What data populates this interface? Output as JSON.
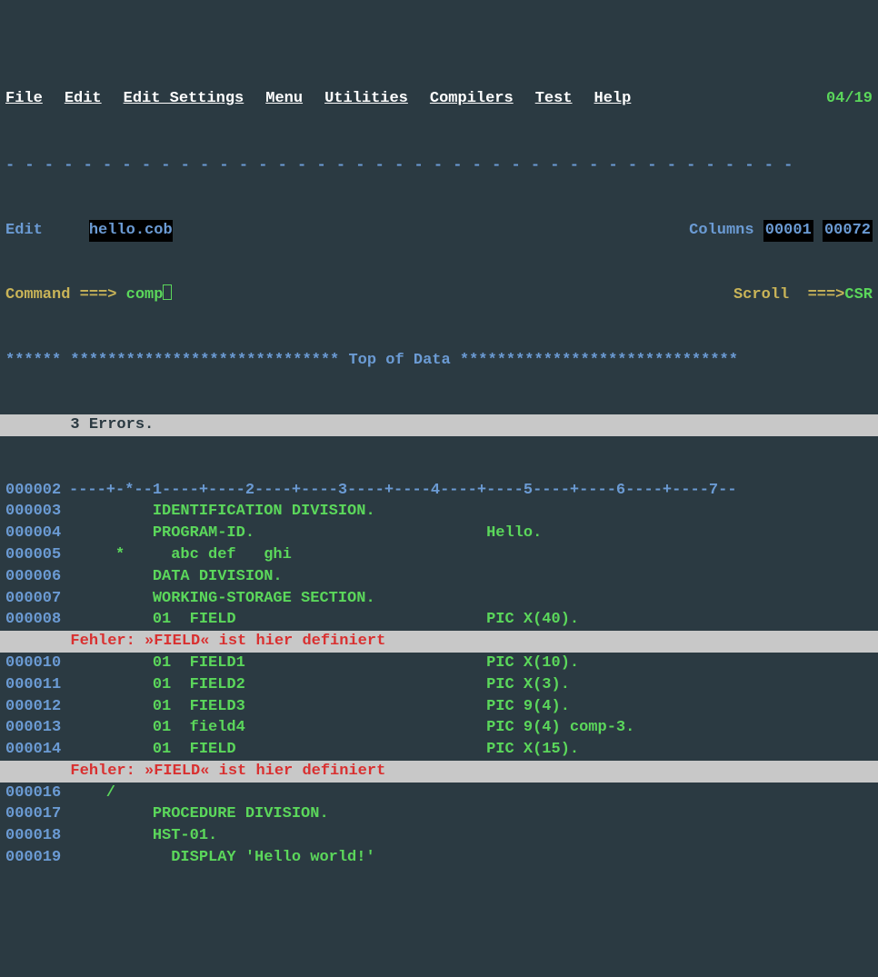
{
  "menu": {
    "items": [
      "File",
      "Edit",
      "Edit_Settings",
      "Menu",
      "Utilities",
      "Compilers",
      "Test",
      "Help"
    ],
    "date": "04/19"
  },
  "divider": "- - - - - - - - - - - - - - - - - - - - - - - - - - - - - - - - - - - - - - - - -",
  "header": {
    "mode": "Edit",
    "filename": "hello.cob",
    "columns_label": "Columns",
    "col_from": "00001",
    "col_to": "00072"
  },
  "command": {
    "label": "Command ===>",
    "value": "comp",
    "scroll_label": "Scroll  ===>",
    "scroll_value": "CSR"
  },
  "top_of_data": "****** ***************************** Top of Data ******************************",
  "error_summary": "       3 Errors.",
  "lines": [
    {
      "num": "000002",
      "type": "ruler",
      "text": "----+-*--1----+----2----+----3----+----4----+----5----+----6----+----7--"
    },
    {
      "num": "000003",
      "type": "code",
      "text": "         IDENTIFICATION DIVISION."
    },
    {
      "num": "000004",
      "type": "code",
      "text": "         PROGRAM-ID.                         Hello."
    },
    {
      "num": "000005",
      "type": "code",
      "text": "     *     abc def   ghi"
    },
    {
      "num": "000006",
      "type": "code",
      "text": "         DATA DIVISION."
    },
    {
      "num": "000007",
      "type": "code",
      "text": "         WORKING-STORAGE SECTION."
    },
    {
      "num": "000008",
      "type": "code",
      "text": "         01  FIELD                           PIC X(40)."
    },
    {
      "type": "error",
      "text": "       Fehler: »FIELD« ist hier definiert"
    },
    {
      "num": "000010",
      "type": "code",
      "text": "         01  FIELD1                          PIC X(10)."
    },
    {
      "num": "000011",
      "type": "code",
      "text": "         01  FIELD2                          PIC X(3)."
    },
    {
      "num": "000012",
      "type": "code",
      "text": "         01  FIELD3                          PIC 9(4)."
    },
    {
      "num": "000013",
      "type": "code",
      "text": "         01  field4                          PIC 9(4) comp-3."
    },
    {
      "num": "000014",
      "type": "code",
      "text": "         01  FIELD                           PIC X(15)."
    },
    {
      "type": "error",
      "text": "       Fehler: »FIELD« ist hier definiert"
    },
    {
      "num": "000016",
      "type": "code",
      "text": "    /"
    },
    {
      "num": "000017",
      "type": "code",
      "text": "         PROCEDURE DIVISION."
    },
    {
      "num": "000018",
      "type": "code",
      "text": "         HST-01."
    },
    {
      "num": "000019",
      "type": "code",
      "text": "           DISPLAY 'Hello world!'"
    }
  ]
}
